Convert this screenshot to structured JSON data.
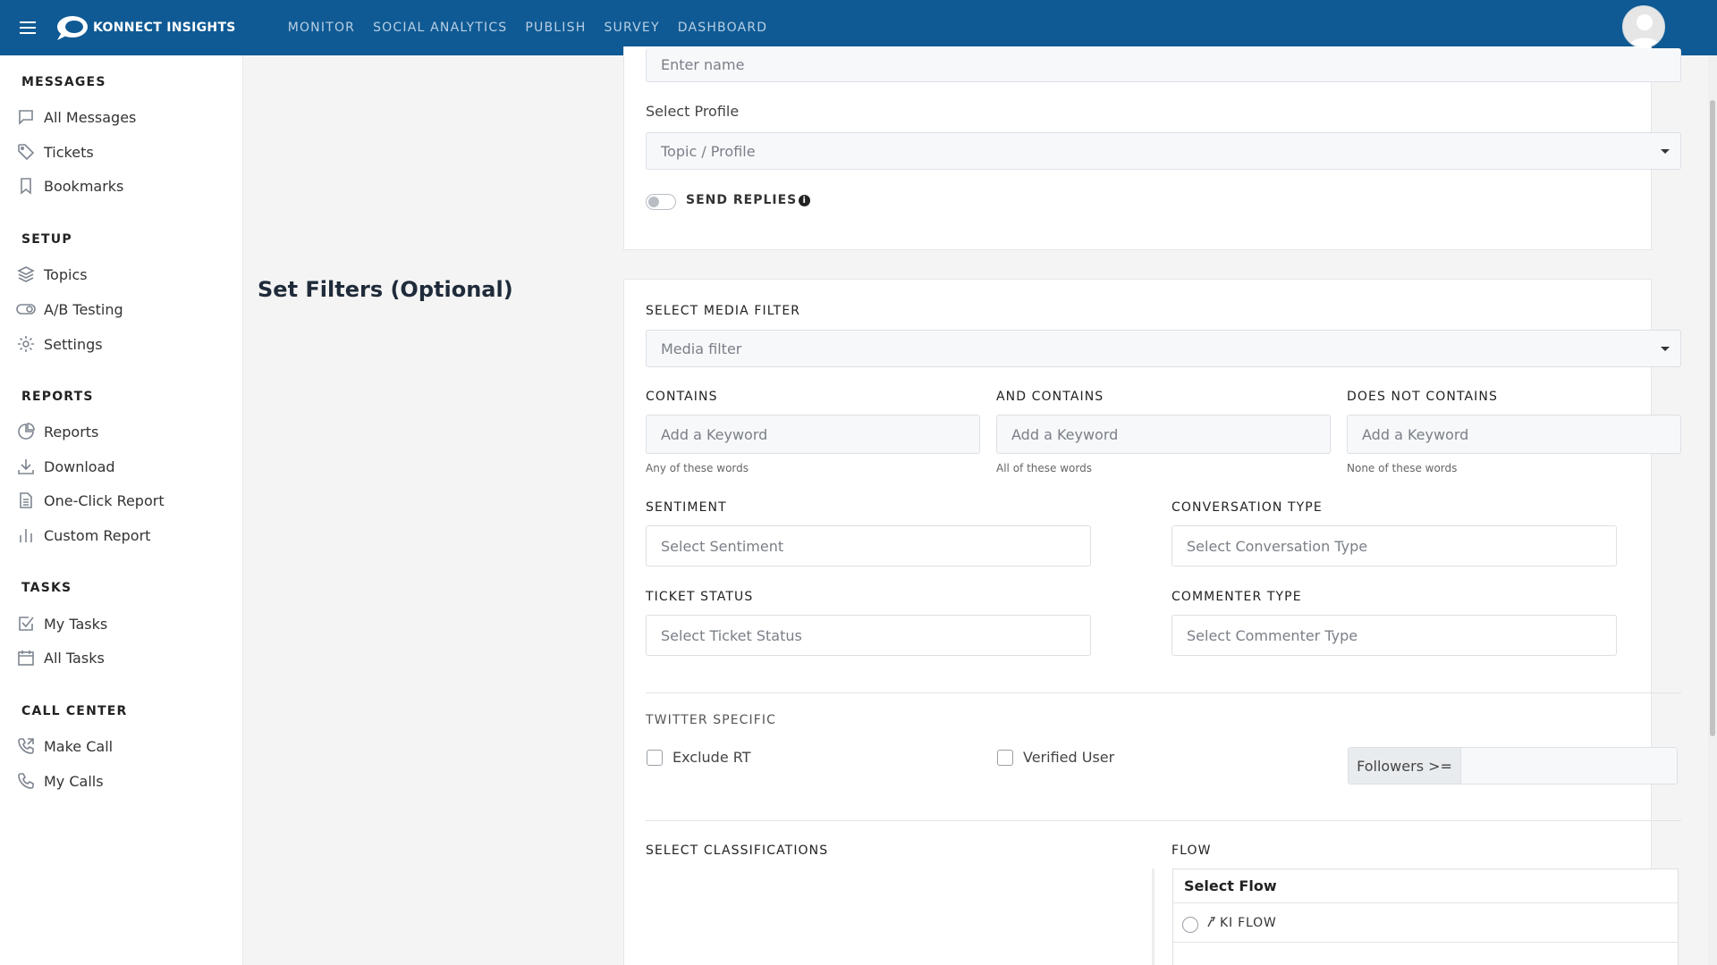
{
  "topbar": {
    "brand": "KONNECT INSIGHTS",
    "nav": [
      "MONITOR",
      "SOCIAL ANALYTICS",
      "PUBLISH",
      "SURVEY",
      "DASHBOARD"
    ]
  },
  "sidebar": {
    "sections": [
      {
        "title": "MESSAGES",
        "items": [
          {
            "label": "All Messages",
            "icon": "message-icon"
          },
          {
            "label": "Tickets",
            "icon": "tag-icon"
          },
          {
            "label": "Bookmarks",
            "icon": "bookmark-icon"
          }
        ]
      },
      {
        "title": "SETUP",
        "items": [
          {
            "label": "Topics",
            "icon": "layers-icon"
          },
          {
            "label": "A/B Testing",
            "icon": "toggle-icon"
          },
          {
            "label": "Settings",
            "icon": "gear-icon"
          }
        ]
      },
      {
        "title": "REPORTS",
        "items": [
          {
            "label": "Reports",
            "icon": "pie-chart-icon"
          },
          {
            "label": "Download",
            "icon": "download-icon"
          },
          {
            "label": "One-Click Report",
            "icon": "document-icon"
          },
          {
            "label": "Custom Report",
            "icon": "bar-chart-icon"
          }
        ]
      },
      {
        "title": "TASKS",
        "items": [
          {
            "label": "My Tasks",
            "icon": "check-square-icon"
          },
          {
            "label": "All Tasks",
            "icon": "calendar-icon"
          }
        ]
      },
      {
        "title": "CALL CENTER",
        "items": [
          {
            "label": "Make Call",
            "icon": "phone-outgoing-icon"
          },
          {
            "label": "My Calls",
            "icon": "phone-icon"
          }
        ]
      }
    ]
  },
  "form": {
    "name_placeholder": "Enter name",
    "select_profile_label": "Select Profile",
    "profile_placeholder": "Topic / Profile",
    "send_replies_label": "SEND REPLIES",
    "filters_title": "Set Filters (Optional)",
    "media_filter_label": "SELECT MEDIA FILTER",
    "media_filter_placeholder": "Media filter",
    "contains_label": "CONTAINS",
    "contains_placeholder": "Add a Keyword",
    "contains_hint": "Any of these words",
    "and_contains_label": "AND CONTAINS",
    "and_contains_placeholder": "Add a Keyword",
    "and_contains_hint": "All of these words",
    "not_contains_label": "DOES NOT CONTAINS",
    "not_contains_placeholder": "Add a Keyword",
    "not_contains_hint": "None of these words",
    "sentiment_label": "SENTIMENT",
    "sentiment_placeholder": "Select Sentiment",
    "conversation_type_label": "CONVERSATION TYPE",
    "conversation_type_placeholder": "Select Conversation Type",
    "ticket_status_label": "TICKET STATUS",
    "ticket_status_placeholder": "Select Ticket Status",
    "commenter_type_label": "COMMENTER TYPE",
    "commenter_type_placeholder": "Select Commenter Type",
    "twitter_specific_label": "TWITTER SPECIFIC",
    "exclude_rt_label": "Exclude RT",
    "verified_user_label": "Verified User",
    "followers_label": "Followers >=",
    "classifications_label": "SELECT CLASSIFICATIONS",
    "flow_label": "FLOW",
    "select_flow_header": "Select Flow",
    "flow_option": "KI FLOW"
  }
}
